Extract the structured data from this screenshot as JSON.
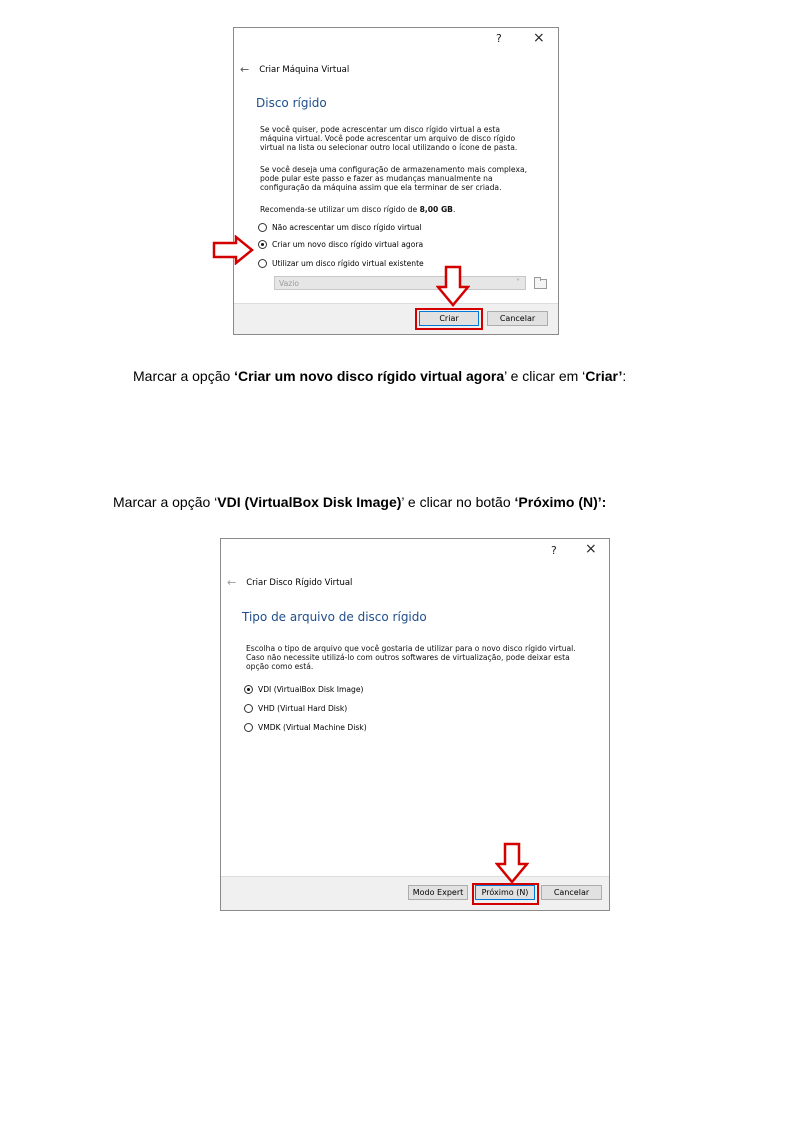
{
  "dialog1": {
    "help": "?",
    "close": "×",
    "back_arrow": "←",
    "title": "Criar Máquina Virtual",
    "heading": "Disco rígido",
    "para1_l1": "Se você quiser, pode acrescentar um disco rígido virtual a esta",
    "para1_l2": "máquina virtual. Você pode acrescentar um arquivo de disco rígido",
    "para1_l3": "virtual na lista ou selecionar outro local utilizando o ícone de pasta.",
    "para2_l1": "Se você deseja uma configuração de armazenamento mais complexa,",
    "para2_l2": "pode pular este passo e fazer as mudanças manualmente na",
    "para2_l3": "configuração da máquina assim que ela terminar de ser criada.",
    "recommend_prefix": "Recomenda-se utilizar um disco rígido de ",
    "recommend_size": "8,00 GB",
    "recommend_suffix": ".",
    "options": [
      {
        "label": "Não acrescentar um disco rígido virtual",
        "selected": false
      },
      {
        "label": "Criar um novo disco rígido virtual agora",
        "selected": true
      },
      {
        "label": "Utilizar um disco rígido virtual existente",
        "selected": false
      }
    ],
    "combo_value": "Vazio",
    "combo_chevron": "˅",
    "create_button": "Criar",
    "cancel_button": "Cancelar"
  },
  "caption1": {
    "p1": "Marcar a opção ",
    "b1": "‘Criar um novo disco rígido virtual agora",
    "p2": "’ e clicar em ‘",
    "b2": "Criar’",
    "p3": ":"
  },
  "caption2": {
    "p1": "Marcar a opção ‘",
    "b1": "VDI (VirtualBox Disk Image)",
    "p2": "’ e clicar no botão ",
    "b2": "‘Próximo (N)’:"
  },
  "dialog2": {
    "help": "?",
    "close": "×",
    "back_arrow": "←",
    "title": "Criar Disco Rígido Virtual",
    "heading": "Tipo de arquivo de disco rígido",
    "para_l1": "Escolha o tipo de arquivo que você gostaria de utilizar para o novo disco rígido virtual.",
    "para_l2": "Caso não necessite utilizá-lo com outros softwares de virtualização, pode deixar esta",
    "para_l3": "opção como está.",
    "options": [
      {
        "label": "VDI (VirtualBox Disk Image)",
        "selected": true
      },
      {
        "label": "VHD (Virtual Hard Disk)",
        "selected": false
      },
      {
        "label": "VMDK (Virtual Machine Disk)",
        "selected": false
      }
    ],
    "expert_button": "Modo Expert",
    "next_button": "Próximo (N)",
    "cancel_button": "Cancelar"
  },
  "colors": {
    "highlight": "#d40000",
    "heading": "#1f4e8c"
  }
}
